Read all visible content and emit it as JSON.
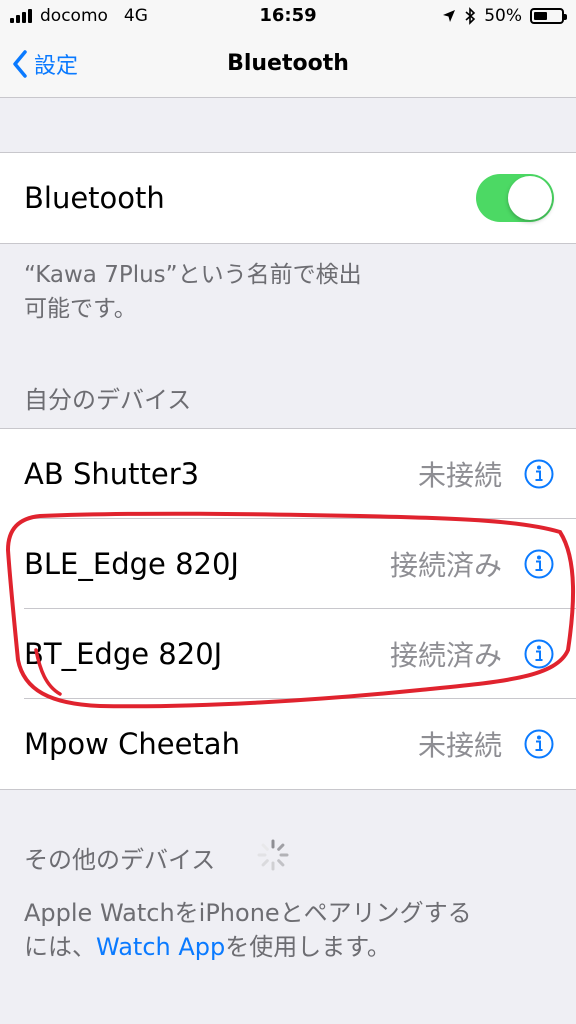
{
  "status_bar": {
    "carrier": "docomo",
    "network": "4G",
    "time": "16:59",
    "battery": "50%",
    "battery_level": 0.5
  },
  "nav": {
    "back_label": "設定",
    "title": "Bluetooth"
  },
  "bluetooth_toggle": {
    "label": "Bluetooth",
    "on": true,
    "on_color": "#4cd964"
  },
  "discoverable_text": {
    "line1": "“Kawa 7Plus”という名前で検出",
    "line2": "可能です。"
  },
  "my_devices": {
    "header": "自分のデバイス",
    "items": [
      {
        "name": "AB Shutter3",
        "status": "未接続"
      },
      {
        "name": "BLE_Edge 820J",
        "status": "接続済み"
      },
      {
        "name": "BT_Edge 820J",
        "status": "接続済み"
      },
      {
        "name": "Mpow Cheetah",
        "status": "未接続"
      }
    ]
  },
  "other_devices": {
    "header": "その他のデバイス",
    "footer_line1": "Apple WatchをiPhoneとペアリングする",
    "footer_prefix": "には、",
    "footer_link": "Watch App",
    "footer_suffix": "を使用します。"
  },
  "colors": {
    "accent": "#0a7aff",
    "annotation": "#e0232e"
  }
}
